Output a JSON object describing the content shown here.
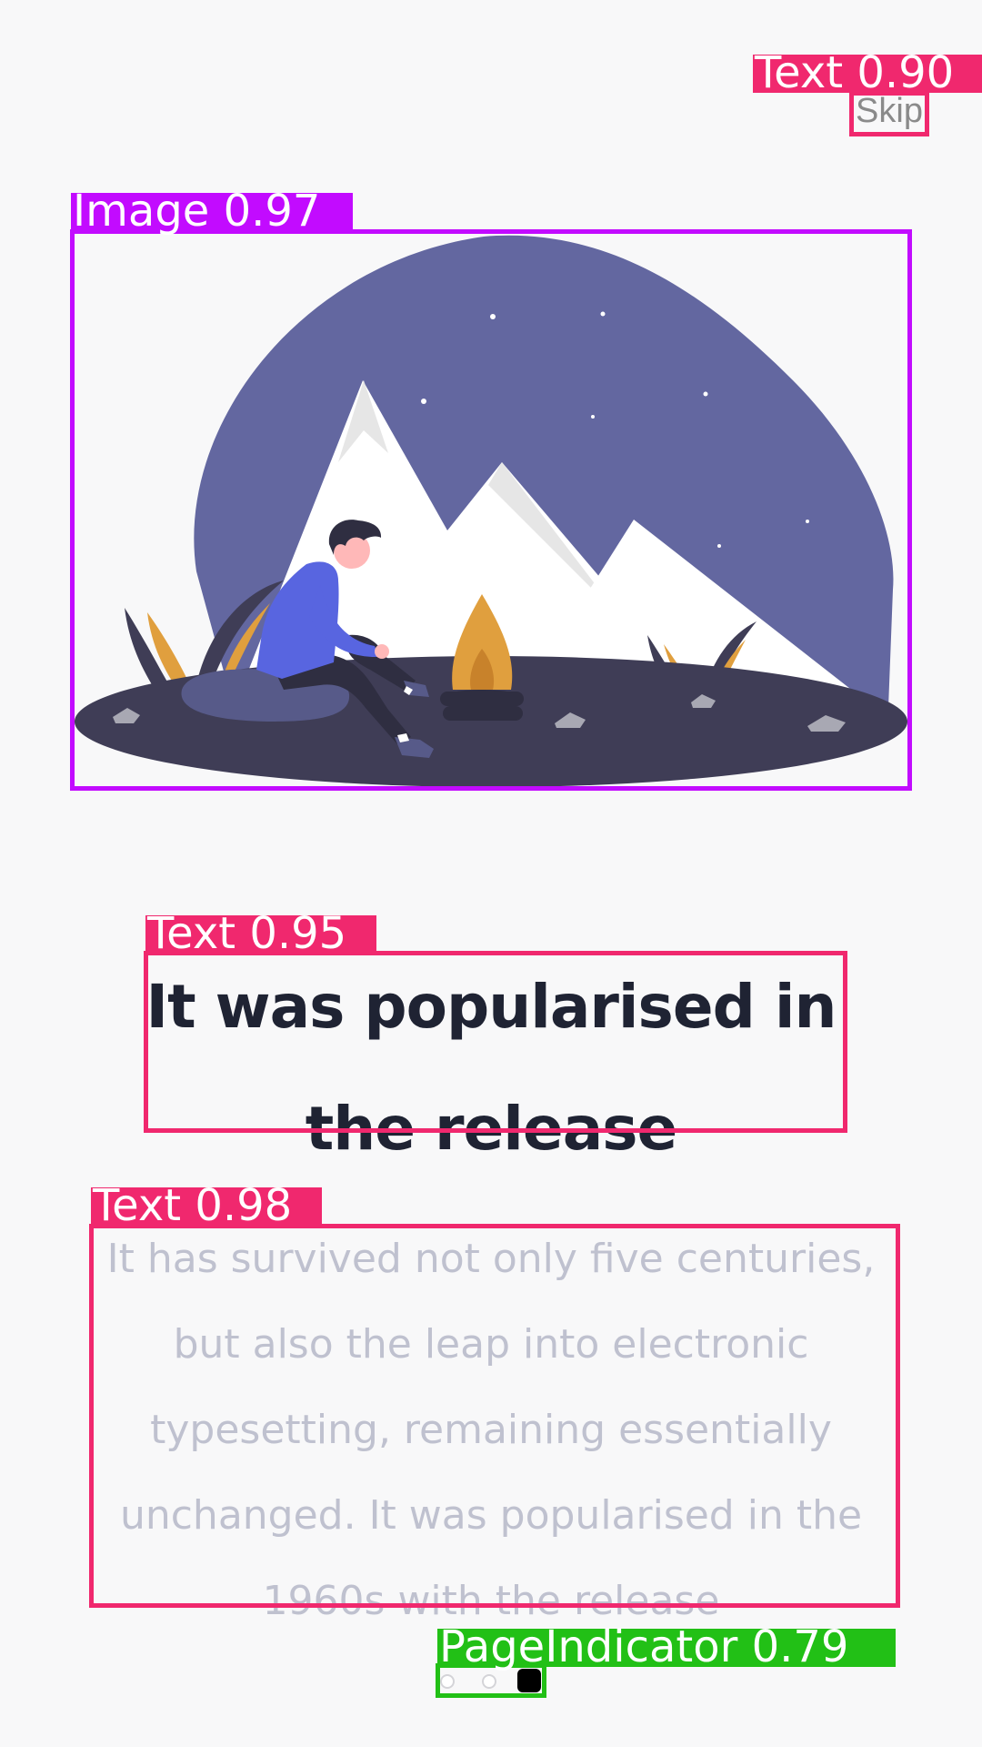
{
  "skip_label": "Skip",
  "title": "It was popularised in the  release",
  "description": "It has survived not only five centuries, but also the leap into electronic typesetting, remaining essentially unchanged. It was popularised in the 1960s with the release",
  "page_indicator": {
    "total_pages": 3,
    "current_page": 3
  },
  "detections": [
    {
      "label": "Text 0.90"
    },
    {
      "label": "Image 0.97"
    },
    {
      "label": "Text 0.95"
    },
    {
      "label": "Text 0.98"
    },
    {
      "label": "PageIndicator 0.79"
    }
  ],
  "colors": {
    "background": "#f8f8f9",
    "title": "#1f2333",
    "description": "#bfc1cf",
    "skip": "#8a8a8a",
    "sky": "#6367a0",
    "ground": "#3f3d56",
    "flame": "#e09f3e",
    "shirt": "#5865e0",
    "detection_text": "#f0286e",
    "detection_image": "#c20bff",
    "detection_indicator": "#22c016"
  }
}
